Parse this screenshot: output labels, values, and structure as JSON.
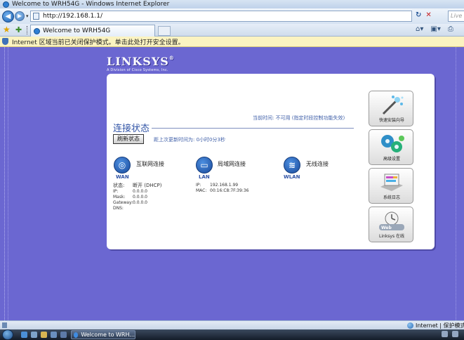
{
  "window": {
    "title": "Welcome to WRH54G - Windows Internet Explorer"
  },
  "address_bar": {
    "url": "http://192.168.1.1/",
    "search_placeholder": "Live Se"
  },
  "tabs": [
    {
      "label": "Welcome to WRH54G"
    }
  ],
  "info_bar": {
    "message": "Internet 区域当前已关闭保护模式。单击此处打开安全设置。"
  },
  "logo": {
    "wordmark": "LINKSYS",
    "registered": "®",
    "tagline": "A Division of Cisco Systems, Inc."
  },
  "status_page": {
    "time_line": "当前时间: 不可用 (指定时段控制功能失效)",
    "title": "连接状态",
    "refresh_label": "刷新状态",
    "last_refresh": "距上次更新时间为: 0小时0分3秒"
  },
  "connections": {
    "wan": {
      "label": "互联网连接",
      "tag": "WAN",
      "status_key": "状态:",
      "status_value": "断开 (DHCP)",
      "ip_key": "IP:",
      "ip": "0.0.0.0",
      "mask_key": "Mask:",
      "mask": "0.0.0.0",
      "gateway_key": "Gateway:",
      "gateway": "0.0.0.0",
      "dns_key": "DNS:",
      "dns": ""
    },
    "lan": {
      "label": "局域网连接",
      "tag": "LAN",
      "ip_key": "IP:",
      "ip": "192.168.1.99",
      "mac_key": "MAC:",
      "mac": "00:16:C8:7F:39:36"
    },
    "wlan": {
      "label": "无线连接",
      "tag": "WLAN"
    }
  },
  "side_buttons": [
    {
      "label": "快速安装向导",
      "icon": "wand-icon"
    },
    {
      "label": "高级设置",
      "icon": "gears-icon"
    },
    {
      "label": "系统日志",
      "icon": "log-icon"
    },
    {
      "label": "Linksys 在线",
      "icon": "web-icon"
    }
  ],
  "status_bar": {
    "zone": "Internet | 保护模式:"
  },
  "taskbar": {
    "window_button": "Welcome to WRH..."
  },
  "colors": {
    "page_background": "#6b67d1",
    "accent_blue": "#3154a6"
  }
}
